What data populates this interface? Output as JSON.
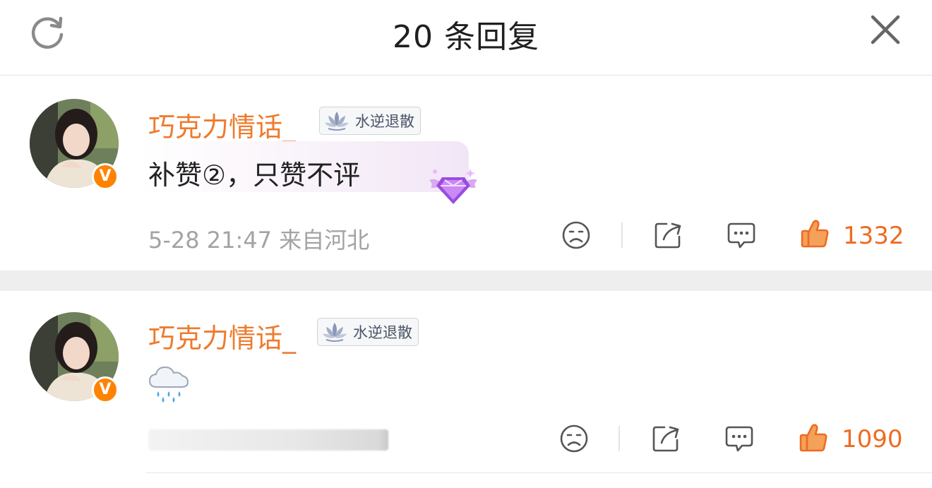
{
  "header": {
    "title": "20 条回复",
    "refresh_icon": "refresh-icon",
    "close_icon": "close-icon"
  },
  "colors": {
    "username": "#ee7b2e",
    "like": "#ee6b22",
    "verified_badge": "#ff8200",
    "separator": "#eeeeee"
  },
  "comments": [
    {
      "username": "巧克力情话_",
      "badge_text": "水逆退散",
      "verified_mark": "V",
      "content": "补赞②，只赞不评",
      "decoration": "purple-diamond-wings-icon",
      "time": "5-28 21:47",
      "location": "来自河北",
      "likes": "1332"
    },
    {
      "username": "巧克力情话_",
      "badge_text": "水逆退散",
      "verified_mark": "V",
      "content_emoji": "rain-cloud-icon",
      "meta_blurred": true,
      "likes": "1090"
    }
  ],
  "actions": [
    "sad-face-icon",
    "share-icon",
    "comment-icon",
    "thumbs-up-icon"
  ]
}
